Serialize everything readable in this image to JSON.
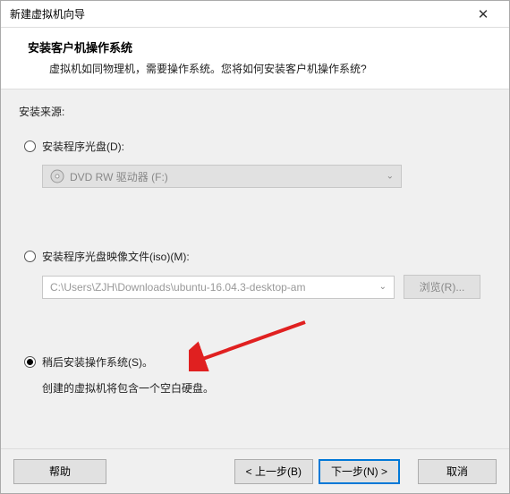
{
  "window": {
    "title": "新建虚拟机向导"
  },
  "header": {
    "title": "安装客户机操作系统",
    "subtitle": "虚拟机如同物理机，需要操作系统。您将如何安装客户机操作系统?"
  },
  "content": {
    "sourceLabel": "安装来源:",
    "optionDisc": {
      "label": "安装程序光盘(D):",
      "dropdown": "DVD RW 驱动器 (F:)"
    },
    "optionIso": {
      "label": "安装程序光盘映像文件(iso)(M):",
      "path": "C:\\Users\\ZJH\\Downloads\\ubuntu-16.04.3-desktop-am",
      "browse": "浏览(R)..."
    },
    "optionLater": {
      "label": "稍后安装操作系统(S)。",
      "note": "创建的虚拟机将包含一个空白硬盘。"
    }
  },
  "footer": {
    "help": "帮助",
    "back": "< 上一步(B)",
    "next": "下一步(N) >",
    "cancel": "取消"
  }
}
